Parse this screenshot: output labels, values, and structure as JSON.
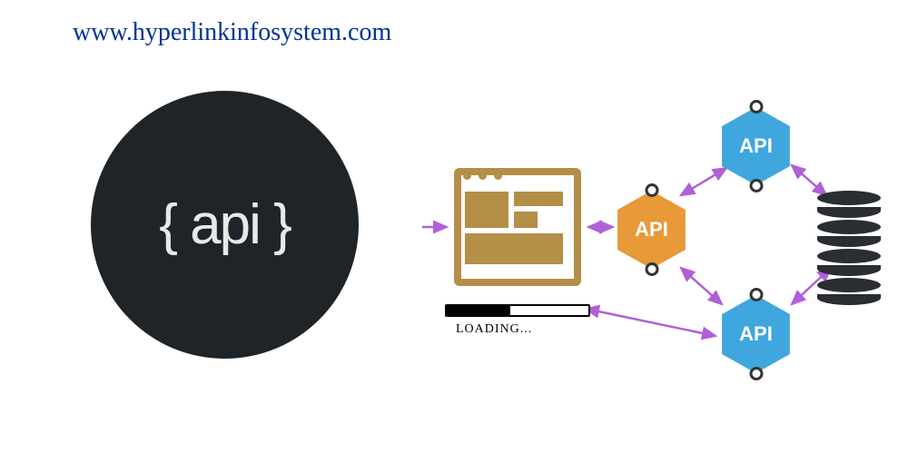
{
  "url": "www.hyperlinkinfosystem.com",
  "api_badge": "{ api }",
  "loading_label": "LOADING...",
  "nodes": {
    "center": {
      "label": "API",
      "color": "orange"
    },
    "top": {
      "label": "API",
      "color": "blue"
    },
    "bottom": {
      "label": "API",
      "color": "blue"
    }
  },
  "database_label": "database",
  "browser_label": "browser-window",
  "arrows": [
    "external-to-browser",
    "browser-to-center",
    "center-to-top",
    "center-to-bottom",
    "top-to-database",
    "bottom-to-database",
    "browser-to-bottom"
  ]
}
